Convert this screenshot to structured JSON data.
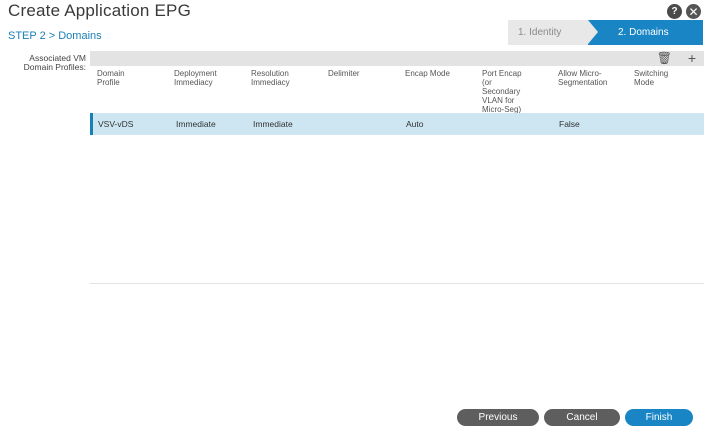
{
  "dialog": {
    "title": "Create Application EPG",
    "help_icon": "question-mark",
    "close_icon": "x",
    "step": "STEP 2 > Domains"
  },
  "wizard": {
    "steps": [
      {
        "label": "1. Identity",
        "active": false
      },
      {
        "label": "2. Domains",
        "active": true
      }
    ]
  },
  "field": {
    "label_line1": "Associated VM",
    "label_line2": "Domain Profiles:"
  },
  "toolbar": {
    "delete_icon": "trash",
    "add_icon": "plus"
  },
  "table": {
    "headers": [
      [
        "Domain",
        "Profile"
      ],
      [
        "Deployment",
        "Immediacy"
      ],
      [
        "Resolution",
        "Immediacy"
      ],
      [
        "Delimiter"
      ],
      [
        "Encap Mode"
      ],
      [
        "Port Encap",
        "(or",
        "Secondary",
        "VLAN for",
        "Micro-Seg)"
      ],
      [
        "Allow Micro-",
        "Segmentation"
      ],
      [
        "Switching",
        "Mode"
      ]
    ],
    "rows": [
      {
        "domain_profile": "VSV-vDS",
        "deployment_immediacy": "Immediate",
        "resolution_immediacy": "Immediate",
        "delimiter": "",
        "encap_mode": "Auto",
        "port_encap": "",
        "allow_micro_segmentation": "False",
        "switching_mode": ""
      }
    ]
  },
  "buttons": {
    "previous": "Previous",
    "cancel": "Cancel",
    "finish": "Finish"
  },
  "colors": {
    "accent": "#1a85c4",
    "selected_row": "#cde6f1",
    "footer_button": "#5e5e5e"
  }
}
